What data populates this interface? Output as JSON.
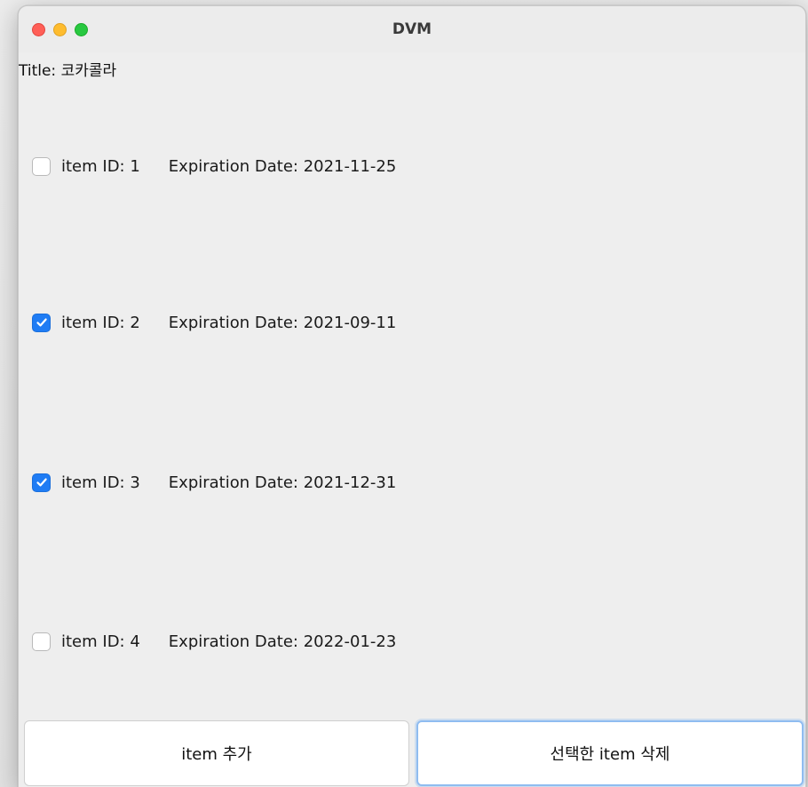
{
  "window": {
    "title": "DVM"
  },
  "header": {
    "title_label": "Title: 코카콜라"
  },
  "items": [
    {
      "id_label": "item ID: 1",
      "expiration_label": "Expiration Date: 2021-11-25",
      "checked": false
    },
    {
      "id_label": "item ID: 2",
      "expiration_label": "Expiration Date: 2021-09-11",
      "checked": true
    },
    {
      "id_label": "item ID: 3",
      "expiration_label": "Expiration Date: 2021-12-31",
      "checked": true
    },
    {
      "id_label": "item ID: 4",
      "expiration_label": "Expiration Date: 2022-01-23",
      "checked": false
    }
  ],
  "buttons": {
    "add_label": "item 추가",
    "delete_label": "선택한 item 삭제"
  },
  "colors": {
    "checkbox_checked": "#1f7cf4",
    "close": "#ff5f57",
    "minimize": "#febc2e",
    "maximize": "#28c840",
    "focus_ring": "#8fbcf0"
  }
}
